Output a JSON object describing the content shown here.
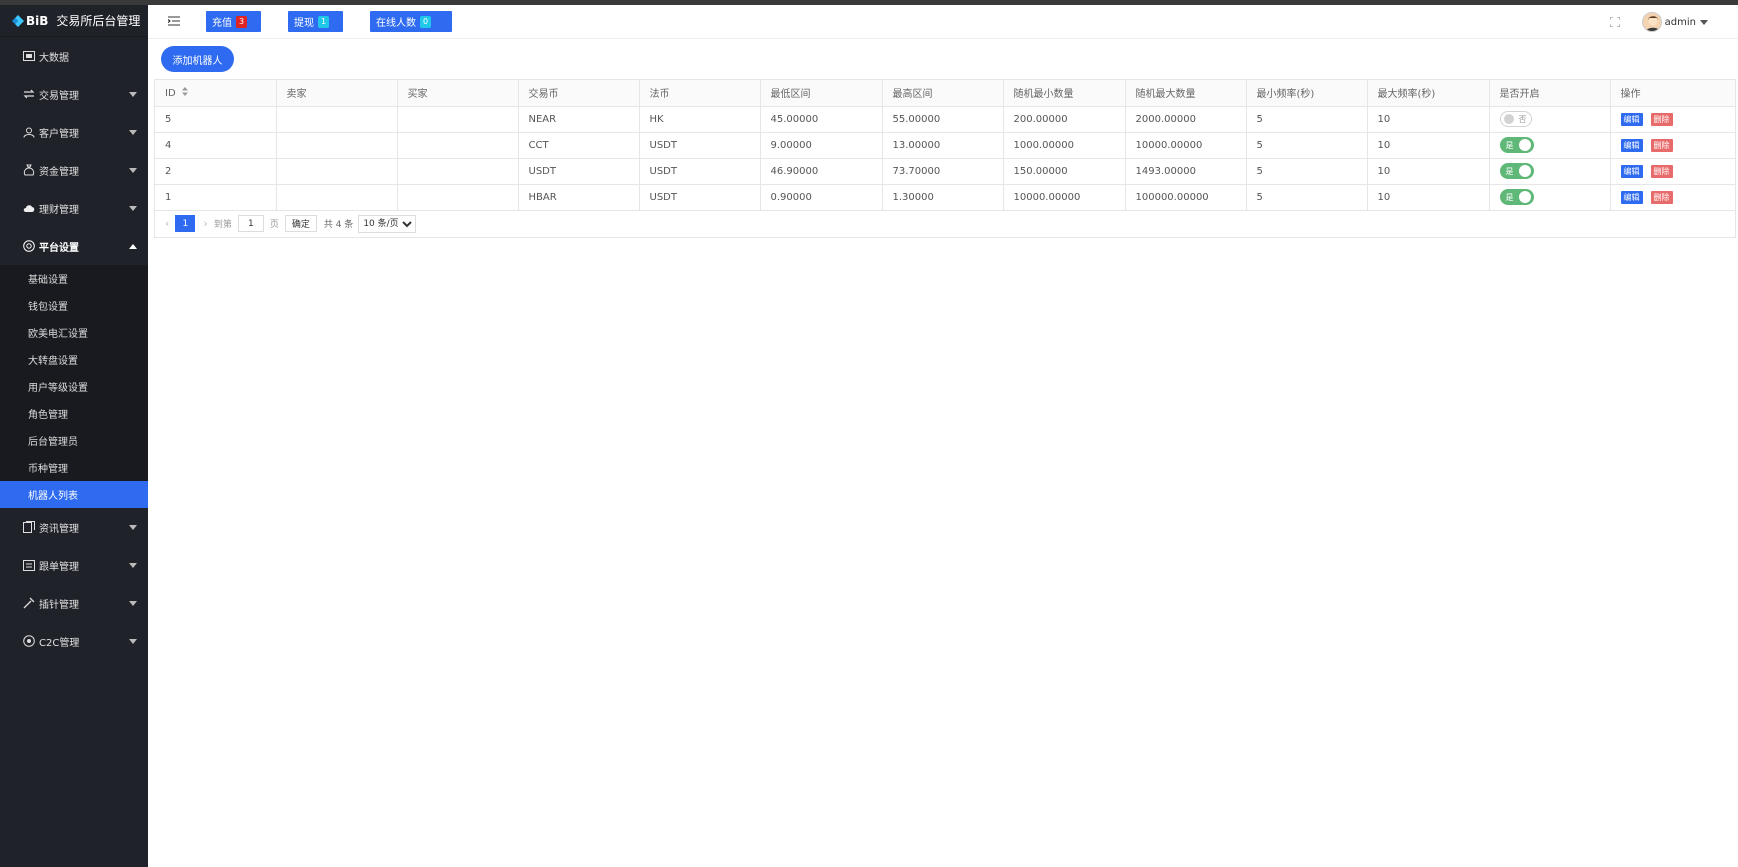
{
  "brand": {
    "logo_text": "BiB",
    "title": "交易所后台管理"
  },
  "sidebar": {
    "items": [
      {
        "label": "大数据",
        "icon": "dashboard-icon"
      },
      {
        "label": "交易管理",
        "icon": "exchange-icon"
      },
      {
        "label": "客户管理",
        "icon": "users-icon"
      },
      {
        "label": "资金管理",
        "icon": "money-bag-icon"
      },
      {
        "label": "理财管理",
        "icon": "cloud-icon"
      },
      {
        "label": "平台设置",
        "icon": "settings-circle-icon"
      },
      {
        "label": "资讯管理",
        "icon": "news-icon"
      },
      {
        "label": "跟单管理",
        "icon": "order-icon"
      },
      {
        "label": "插针管理",
        "icon": "needle-icon"
      },
      {
        "label": "C2C管理",
        "icon": "c2c-icon"
      }
    ],
    "platform_sub": [
      "基础设置",
      "钱包设置",
      "欧美电汇设置",
      "大转盘设置",
      "用户等级设置",
      "角色管理",
      "后台管理员",
      "币种管理",
      "机器人列表"
    ]
  },
  "topbar": {
    "recharge": {
      "label": "充值",
      "count": "3"
    },
    "withdraw": {
      "label": "提现",
      "count": "1"
    },
    "online": {
      "label": "在线人数",
      "count": "0"
    },
    "user": "admin"
  },
  "main": {
    "add_button": "添加机器人",
    "columns": [
      "ID",
      "卖家",
      "买家",
      "交易币",
      "法币",
      "最低区间",
      "最高区间",
      "随机最小数量",
      "随机最大数量",
      "最小频率(秒)",
      "最大频率(秒)",
      "是否开启",
      "操作"
    ],
    "rows": [
      [
        "5",
        "",
        "",
        "NEAR",
        "HK",
        "45.00000",
        "55.00000",
        "200.00000",
        "2000.00000",
        "5",
        "10"
      ],
      [
        "4",
        "",
        "",
        "CCT",
        "USDT",
        "9.00000",
        "13.00000",
        "1000.00000",
        "10000.00000",
        "5",
        "10"
      ],
      [
        "2",
        "",
        "",
        "USDT",
        "USDT",
        "46.90000",
        "73.70000",
        "150.00000",
        "1493.00000",
        "5",
        "10"
      ],
      [
        "1",
        "",
        "",
        "HBAR",
        "USDT",
        "0.90000",
        "1.30000",
        "10000.00000",
        "100000.00000",
        "5",
        "10"
      ]
    ],
    "enabled": [
      false,
      true,
      true,
      true
    ],
    "switch_on": "是",
    "switch_off": "否",
    "edit_label": "编辑",
    "delete_label": "删除"
  },
  "pager": {
    "current": "1",
    "goto_label": "到第",
    "page_value": "1",
    "page_suffix": "页",
    "confirm": "确定",
    "total": "共 4 条",
    "page_size": "10 条/页"
  },
  "colors": {
    "sidebar_bg": "#20222a",
    "accent": "#2f6bf0",
    "switch_on": "#5fb878",
    "delete": "#e86b6b",
    "badge_red": "#e02424",
    "badge_cyan": "#1fc7e8"
  }
}
